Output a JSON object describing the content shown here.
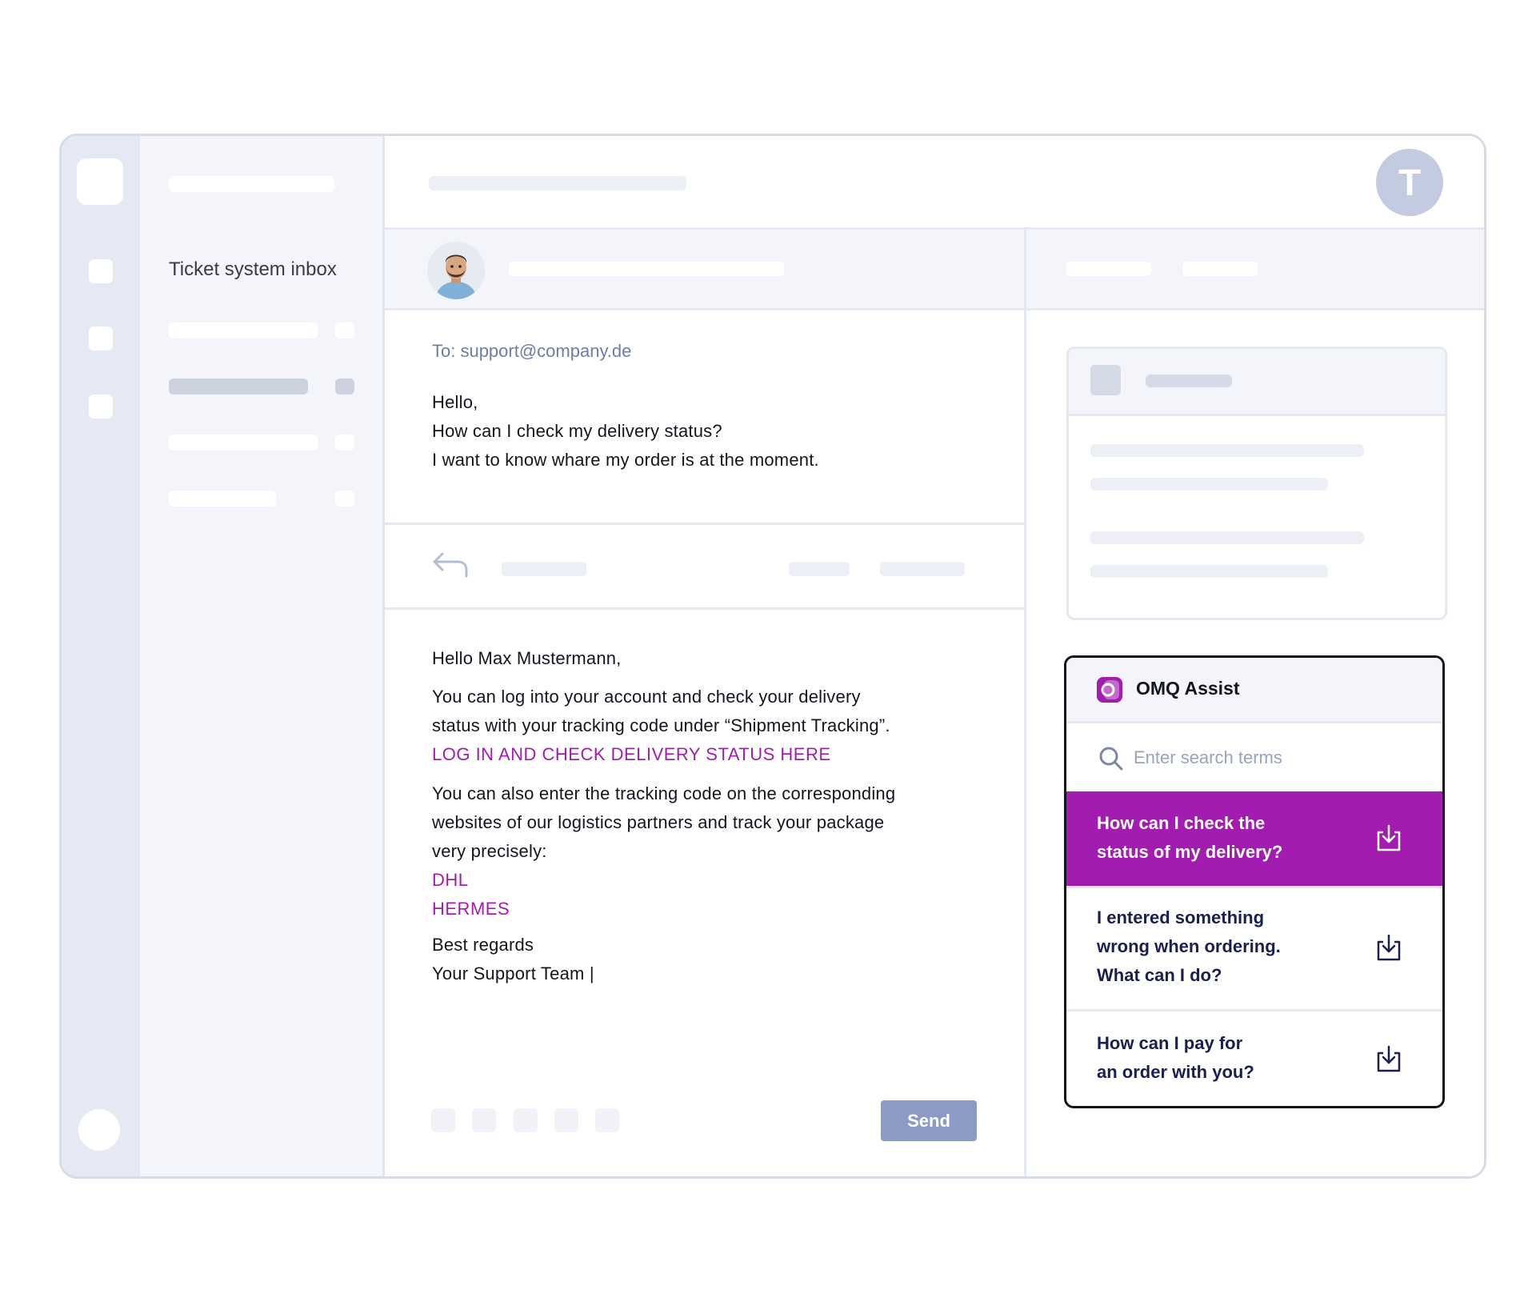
{
  "sidebar": {
    "title": "Ticket system inbox"
  },
  "topbar": {
    "user_initial": "T"
  },
  "email": {
    "to": "To: support@company.de",
    "lines": [
      "Hello,",
      "How can I check my delivery status?",
      "I want to know whare my order is at the moment."
    ]
  },
  "reply": {
    "greeting": "Hello Max Mustermann,",
    "p1_line1": "You can log into your account and check your delivery",
    "p1_line2": "status with your tracking code under “Shipment Tracking”.",
    "login_link": "LOG IN AND CHECK DELIVERY STATUS HERE",
    "p2_line1": "You can also enter the tracking code on the corresponding",
    "p2_line2": "websites of our logistics partners and track your package",
    "p2_line3": "very precisely:",
    "link_dhl": "DHL",
    "link_hermes": "HERMES",
    "closing1": "Best regards",
    "closing2": "Your Support Team |",
    "send_label": "Send"
  },
  "assist": {
    "title": "OMQ Assist",
    "search_placeholder": "Enter search terms",
    "results": [
      {
        "line1": "How can I check the",
        "line2": "status of my delivery?"
      },
      {
        "line1": "I entered something",
        "line2": "wrong when ordering.",
        "line3": "What can I do?"
      },
      {
        "line1": "How can I pay for",
        "line2": "an order with you?"
      }
    ]
  },
  "colors": {
    "accent": "#a21caf",
    "send_button": "#8e9ac6",
    "avatar": "#c3cbe1",
    "rail": "#e5e9f3"
  }
}
